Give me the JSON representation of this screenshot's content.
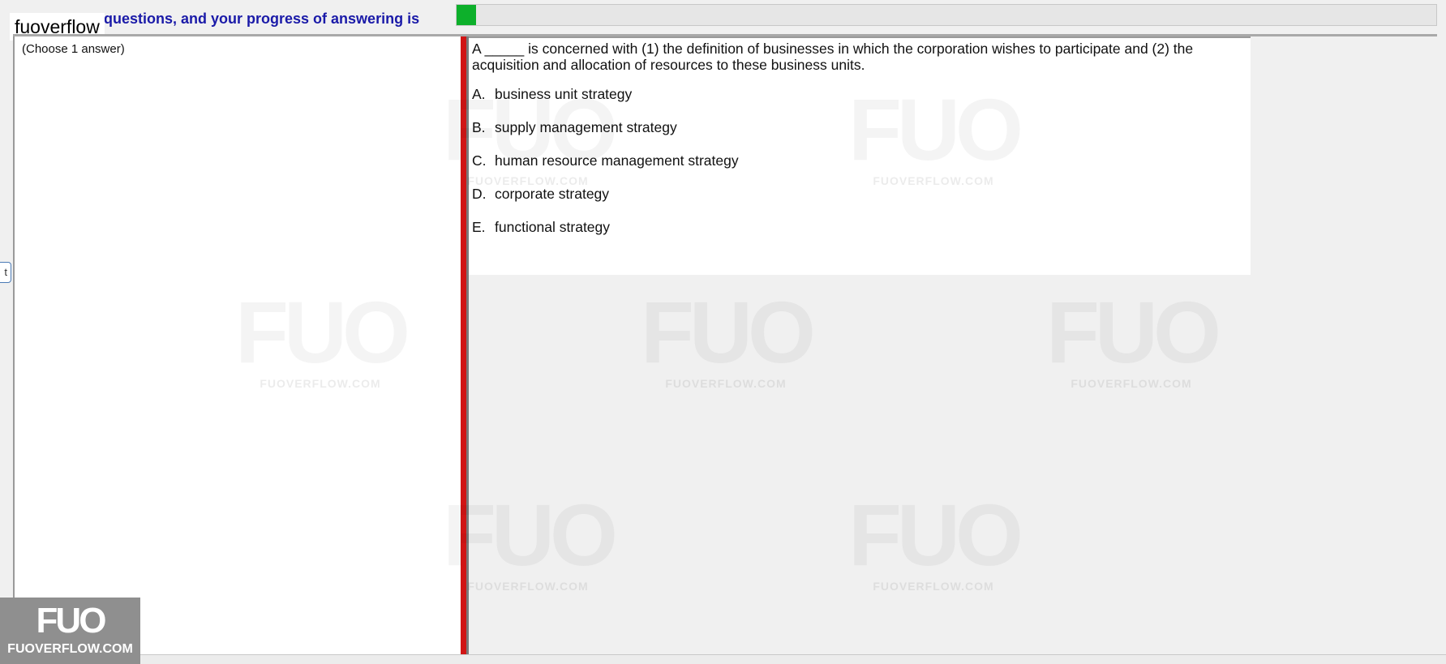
{
  "header": {
    "brand": "fuoverflow",
    "progress_text": "questions, and your progress of answering is",
    "progress_fraction": 0.02,
    "progress_color": "#0db02b"
  },
  "left_panel": {
    "hint": "(Choose 1 answer)",
    "side_tab_glyph": "t"
  },
  "question": {
    "text": "A _____ is concerned with (1) the definition of businesses in which the corporation wishes to participate and (2) the acquisition and allocation of resources to these business units.",
    "options": [
      {
        "letter": "A.",
        "text": "business unit strategy"
      },
      {
        "letter": "B.",
        "text": "supply management strategy"
      },
      {
        "letter": "C.",
        "text": "human resource management strategy"
      },
      {
        "letter": "D.",
        "text": "corporate strategy"
      },
      {
        "letter": "E.",
        "text": "functional strategy"
      }
    ]
  },
  "watermark": {
    "big": "FUO",
    "small": "FUOVERFLOW.COM"
  },
  "corner_logo": {
    "big": "FUO",
    "small": "FUOVERFLOW.COM"
  },
  "colors": {
    "splitter": "#d01515",
    "progress_text": "#1a1aa8"
  }
}
